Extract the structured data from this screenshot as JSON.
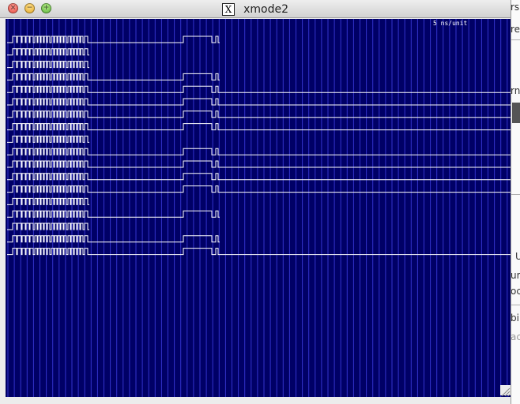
{
  "window": {
    "title": "xmode2",
    "title_icon": "X",
    "buttons": [
      "close",
      "minimize",
      "zoom"
    ]
  },
  "display": {
    "scale_label": "5 ns/unit",
    "background_color": "#000066",
    "grid_color": "#3333cc",
    "trace_color": "#ffffff",
    "channel_count": 18,
    "active_channels": [
      1,
      4,
      5,
      6,
      7,
      8,
      10,
      11,
      12,
      13,
      15,
      17,
      18
    ],
    "long_channels": [
      5,
      6,
      7,
      8,
      10,
      11,
      12,
      13,
      18
    ]
  },
  "background_window": {
    "fragments": [
      {
        "id": "frag-1",
        "text": "rs"
      },
      {
        "id": "frag-2",
        "text": "re"
      },
      {
        "id": "frag-3",
        "text": "rn"
      },
      {
        "id": "frag-4",
        "text": "U"
      },
      {
        "id": "frag-5",
        "text": "ur"
      },
      {
        "id": "frag-6",
        "text": "oc"
      },
      {
        "id": "frag-7",
        "text": "bi"
      },
      {
        "id": "frag-8",
        "text": "ac"
      }
    ]
  }
}
